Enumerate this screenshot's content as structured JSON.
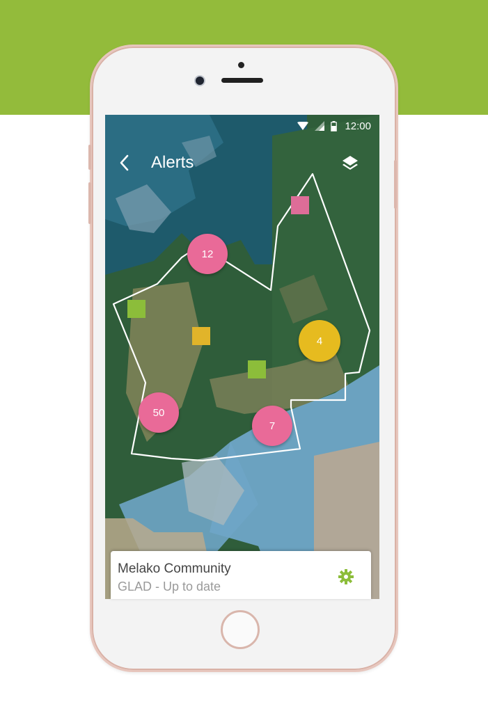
{
  "colors": {
    "brand_green": "#93bb3b",
    "alert_pink": "#e96a98",
    "alert_yellow": "#e6bb1f",
    "square_green": "#8cbd3a",
    "square_pink": "#de6d98",
    "square_yellow": "#e1b42a",
    "boundary": "#ffffff",
    "water": "#6fa5c7",
    "forest": "#2e5b3a"
  },
  "status_bar": {
    "time": "12:00",
    "icons": [
      "wifi-icon",
      "signal-icon",
      "battery-icon"
    ]
  },
  "app_bar": {
    "title": "Alerts",
    "back_icon": "chevron-left-icon",
    "layers_icon": "layers-icon"
  },
  "map": {
    "clusters": [
      {
        "count": "12",
        "color": "pink"
      },
      {
        "count": "4",
        "color": "yellow"
      },
      {
        "count": "50",
        "color": "pink"
      },
      {
        "count": "7",
        "color": "pink"
      }
    ],
    "alert_squares": [
      "green",
      "pink",
      "yellow",
      "green"
    ]
  },
  "area_card": {
    "name": "Melako Community",
    "status": "GLAD - Up to date",
    "settings_icon": "gear-icon"
  }
}
